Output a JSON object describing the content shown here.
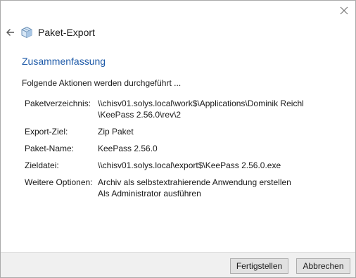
{
  "window": {
    "close_icon": "close-icon"
  },
  "header": {
    "back_icon": "back-arrow-icon",
    "package_icon": "package-icon",
    "title": "Paket-Export"
  },
  "content": {
    "section_title": "Zusammenfassung",
    "intro": "Folgende Aktionen werden durchgeführt ...",
    "summary": [
      {
        "label": "Paketverzeichnis:",
        "lines": [
          "\\\\chisv01.solys.local\\work$\\Applications\\Dominik Reichl",
          "\\KeePass 2.56.0\\rev\\2"
        ]
      },
      {
        "label": "Export-Ziel:",
        "lines": [
          "Zip Paket"
        ]
      },
      {
        "label": "Paket-Name:",
        "lines": [
          "KeePass 2.56.0"
        ]
      },
      {
        "label": "Zieldatei:",
        "lines": [
          "\\\\chisv01.solys.local\\export$\\KeePass 2.56.0.exe"
        ]
      },
      {
        "label": "Weitere Optionen:",
        "lines": [
          "Archiv als selbstextrahierende Anwendung erstellen",
          "Als Administrator ausführen"
        ]
      }
    ]
  },
  "footer": {
    "finish_label": "Fertigstellen",
    "cancel_label": "Abbrechen"
  },
  "colors": {
    "accent": "#1e5aa8",
    "footer_bg": "#f0f0f0",
    "button_bg": "#e1e1e1"
  }
}
